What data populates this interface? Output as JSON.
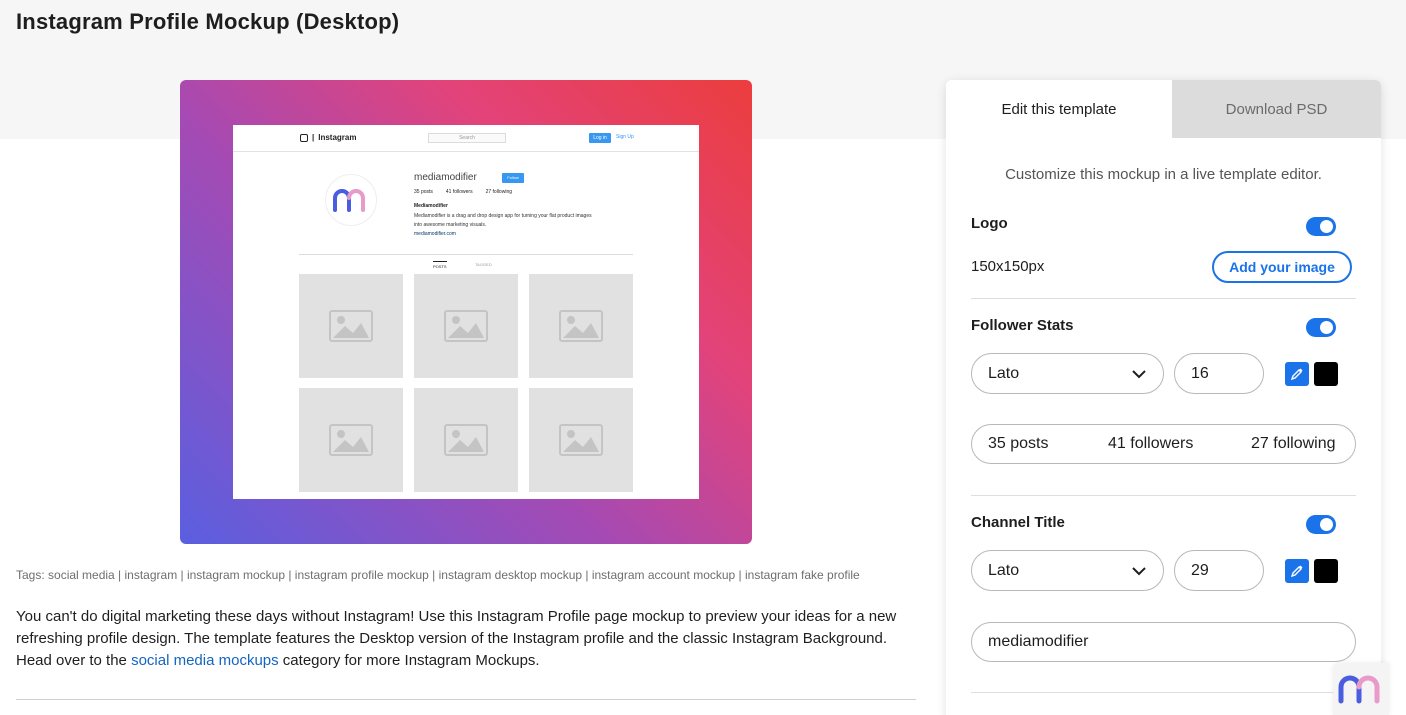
{
  "page": {
    "title": "Instagram Profile Mockup (Desktop)"
  },
  "mockup": {
    "ig_brand": "Instagram",
    "search_placeholder": "Search",
    "login_label": "Log in",
    "signup_label": "Sign Up",
    "username": "mediamodifier",
    "follow_label": "Follow",
    "stats": [
      "35 posts",
      "41 followers",
      "27 following"
    ],
    "display_name": "Mediamodifier",
    "bio": "Mediamodifier is a drag and drop design app for turning your flat product images into awesome marketing visuals.",
    "website": "mediamodifier.com",
    "tab_posts": "POSTS",
    "tab_tagged": "TAGGED",
    "gradient_colors": [
      "#ec3d3d",
      "#e2437a",
      "#a64ab3",
      "#5a5fe0"
    ]
  },
  "tags": "Tags: social media | instagram | instagram mockup | instagram profile mockup | instagram desktop mockup | instagram account mockup | instagram fake profile",
  "description": {
    "before_link": "You can't do digital marketing these days without Instagram! Use this Instagram Profile page mockup to preview your ideas for a new refreshing profile design. The template features the Desktop version of the Instagram profile and the classic Instagram Background. Head over to the ",
    "link_text": "social media mockups",
    "after_link": " category for more Instagram Mockups."
  },
  "panel": {
    "tab_edit": "Edit this template",
    "tab_download": "Download PSD",
    "subtitle": "Customize this mockup in a live template editor.",
    "accent_color": "#1a73e8",
    "logo": {
      "label": "Logo",
      "size": "150x150px",
      "add_button": "Add your image",
      "enabled": true
    },
    "follower_stats": {
      "label": "Follower Stats",
      "font": "Lato",
      "font_size": "16",
      "color": "#000000",
      "enabled": true,
      "values": [
        "35 posts",
        "41 followers",
        "27 following"
      ]
    },
    "channel_title": {
      "label": "Channel Title",
      "font": "Lato",
      "font_size": "29",
      "color": "#000000",
      "value": "mediamodifier",
      "enabled": true
    }
  }
}
